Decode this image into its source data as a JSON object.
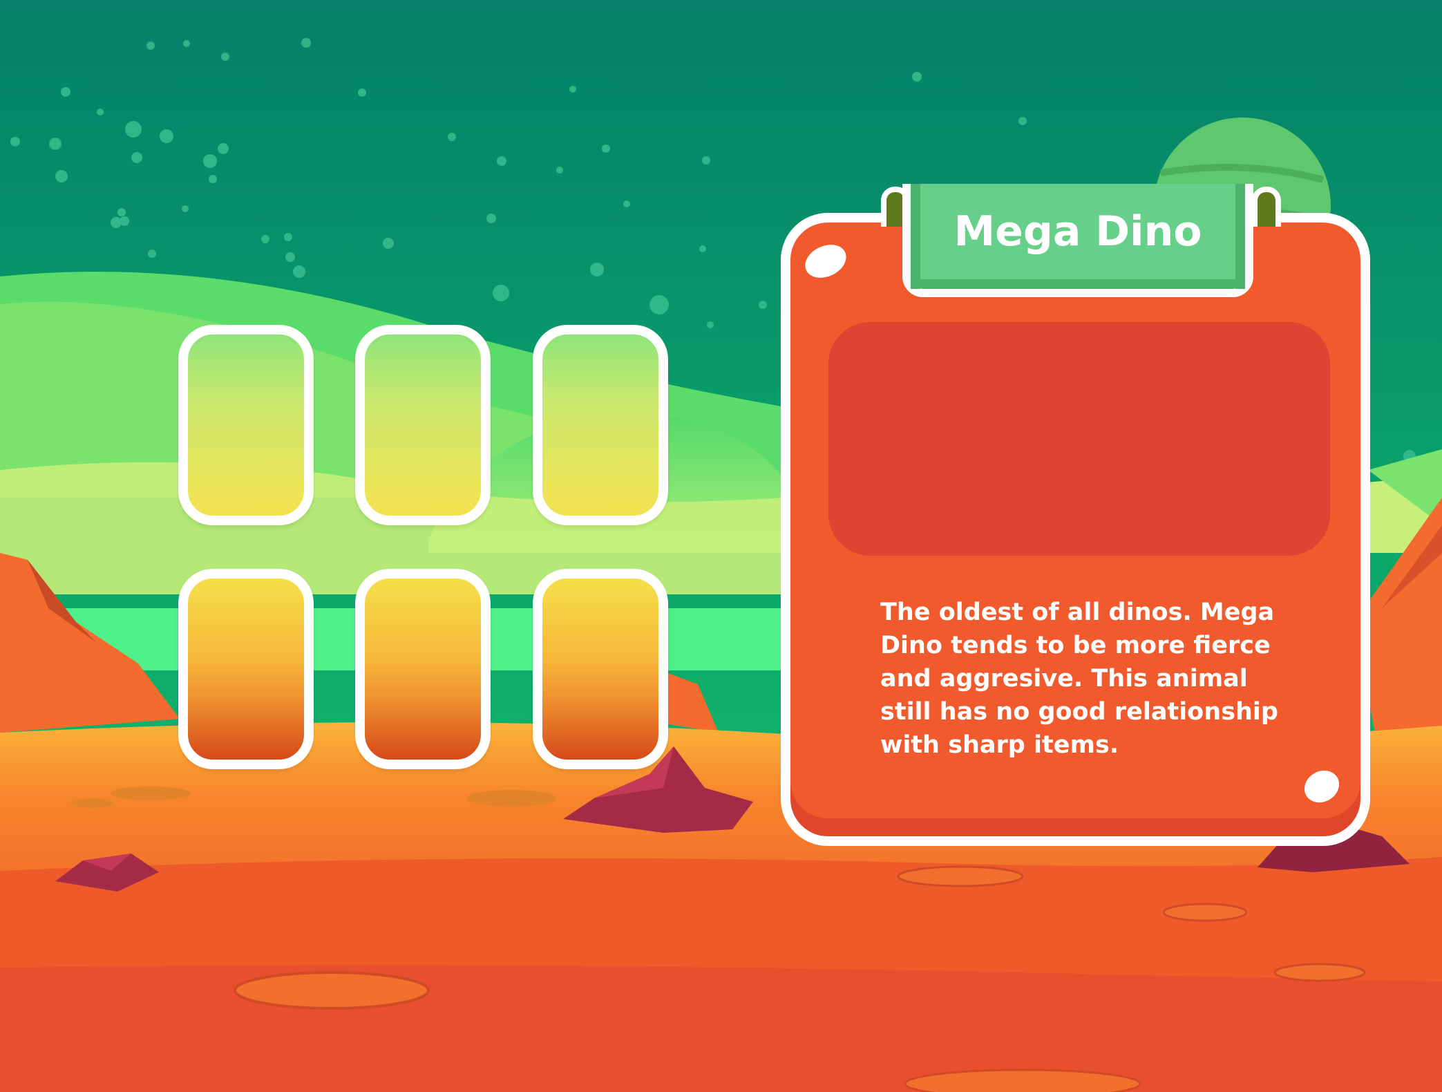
{
  "card": {
    "title": "Mega Dino",
    "description": "The oldest of all dinos. Mega Dino tends to be more fierce and aggresive. This animal still has no good relationship with sharp items."
  },
  "slots": {
    "rows": 2,
    "columns": 3,
    "filled": 0
  },
  "colors": {
    "sky": "#0aa96a",
    "ground": "#f0622c",
    "panel": "#f05a2d",
    "panel_inner": "#e04332",
    "banner": "#66cf8a",
    "slot_top": "#f4e24f",
    "slot_bottom": "#d64a1a"
  }
}
